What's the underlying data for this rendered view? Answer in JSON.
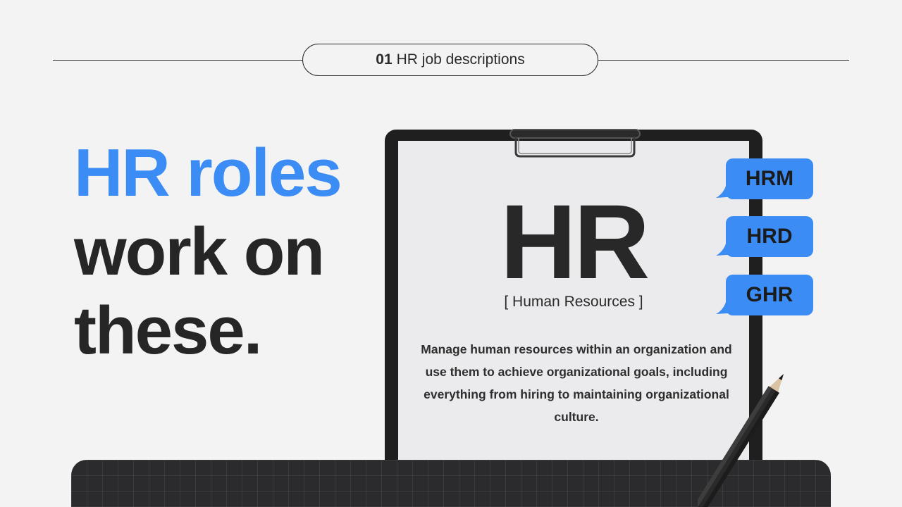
{
  "section": {
    "number": "01",
    "title": "HR job descriptions"
  },
  "headline": {
    "line1": "HR roles",
    "line2": "work on",
    "line3": "these."
  },
  "clipboard": {
    "big_title": "HR",
    "subtitle": "[ Human Resources ]",
    "description": "Manage human resources within an organization and use them to achieve organizational goals, including everything from hiring to maintaining organizational culture."
  },
  "tags": [
    "HRM",
    "HRD",
    "GHR"
  ],
  "colors": {
    "accent": "#3b8cf5",
    "dark": "#262626",
    "background": "#f3f3f4"
  }
}
